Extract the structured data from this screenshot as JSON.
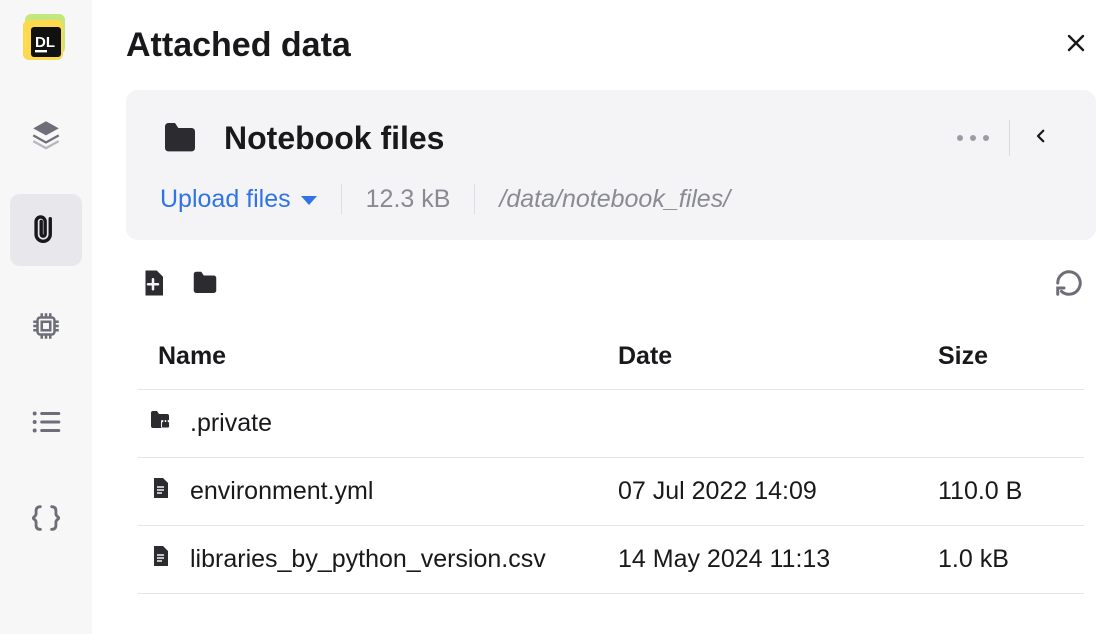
{
  "page": {
    "title": "Attached data"
  },
  "panel": {
    "title": "Notebook files",
    "upload_label": "Upload files",
    "total_size": "12.3 kB",
    "path": "/data/notebook_files/"
  },
  "table": {
    "headers": {
      "name": "Name",
      "date": "Date",
      "size": "Size"
    },
    "rows": [
      {
        "icon": "private-folder",
        "name": ".private",
        "date": "",
        "size": ""
      },
      {
        "icon": "file",
        "name": "environment.yml",
        "date": "07 Jul 2022 14:09",
        "size": "110.0 B"
      },
      {
        "icon": "file",
        "name": "libraries_by_python_version.csv",
        "date": "14 May 2024 11:13",
        "size": "1.0 kB"
      }
    ]
  }
}
